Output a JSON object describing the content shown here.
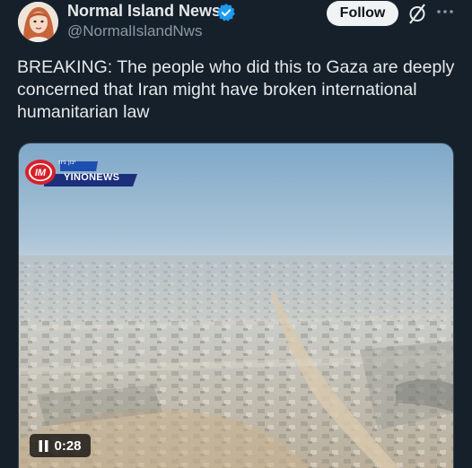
{
  "author": {
    "name": "Normal Island News",
    "handle": "@NormalIslandNws",
    "verified": true
  },
  "actions": {
    "follow_label": "Follow"
  },
  "tweet": {
    "text": "BREAKING: The people who did this to Gaza are deeply concerned that Iran might have broken international humanitarian law"
  },
  "media": {
    "channel_name": "YINONEWS",
    "channel_subtitle": "ינון ניוז",
    "channel_logo_text": "IM",
    "video_time": "0:28"
  },
  "icons": {
    "verified": "verified-badge-icon",
    "grok": "grok-icon",
    "more": "more-options-icon",
    "pause": "pause-icon"
  },
  "colors": {
    "background": "#15202b",
    "verified_blue": "#1d9bf0",
    "follow_bg": "#eff3f4",
    "secondary_text": "#8b98a5"
  }
}
